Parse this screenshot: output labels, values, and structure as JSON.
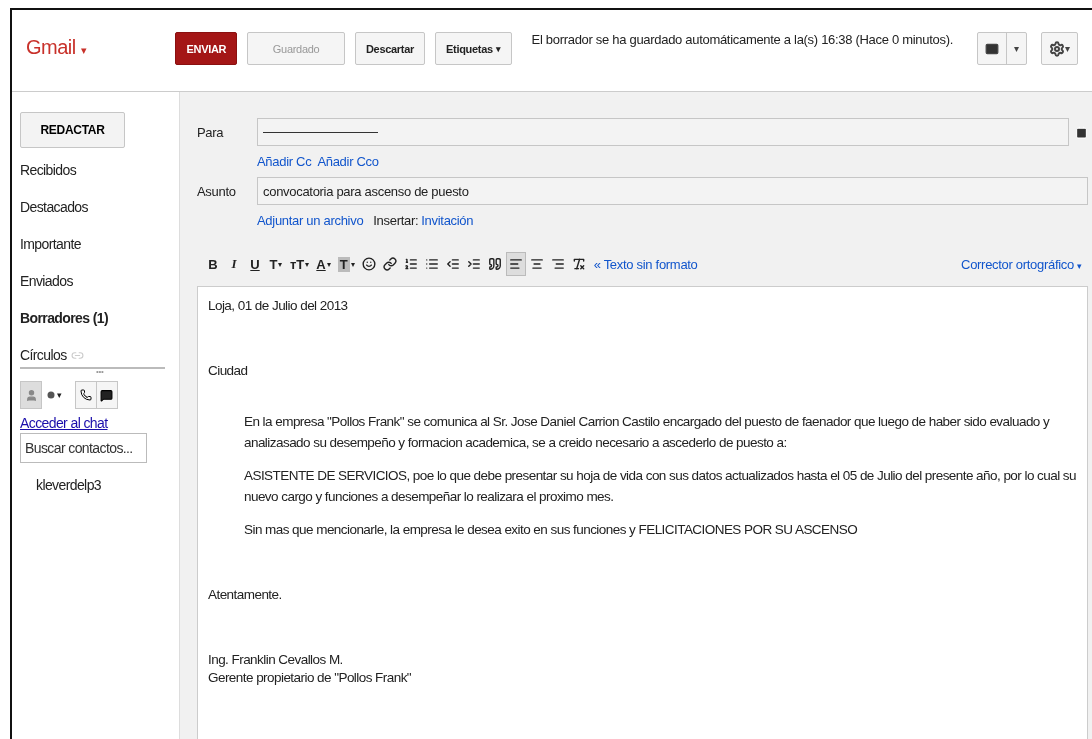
{
  "app": {
    "logo": "Gmail",
    "logo_caret": "▾"
  },
  "top_bar": {
    "send": "ENVIAR",
    "saved": {
      "label": "Guardado",
      "disabled": true
    },
    "discard": "Descartar",
    "labels": {
      "label": "Etiquetas",
      "caret": "▾"
    },
    "status": "El borrador se ha guardado automáticamente a la(s) 16:38 (Hace 0 minutos).",
    "settings_caret": "▾",
    "view_caret": "▾"
  },
  "sidebar": {
    "compose": "REDACTAR",
    "items": [
      {
        "label": "Recibidos",
        "selected": false
      },
      {
        "label": "Destacados",
        "selected": false
      },
      {
        "label": "Importante",
        "selected": false
      },
      {
        "label": "Enviados",
        "selected": false
      },
      {
        "label": "Borradores (1)",
        "selected": true
      }
    ],
    "circles": "Círculos",
    "more": "•••",
    "status_caret": "▾",
    "chat_link": "Acceder al chat",
    "contact_search": {
      "placeholder": "Buscar contactos..."
    },
    "contacts": [
      "kleverdelp3"
    ]
  },
  "compose": {
    "to_label": "Para",
    "add_cc": "Añadir Cc",
    "add_bcc": "Añadir Cco",
    "subject_label": "Asunto",
    "subject": "convocatoria para ascenso de puesto",
    "attach": "Adjuntar un archivo",
    "insert_label": "Insertar:",
    "insert_link": "Invitación",
    "format_buttons": [
      {
        "kind": "bold",
        "label": "B",
        "selected": false
      },
      {
        "kind": "italic",
        "label": "I",
        "selected": false
      },
      {
        "kind": "underline",
        "label": "U",
        "selected": false
      },
      {
        "kind": "font",
        "label": "T",
        "caret": "▾",
        "selected": false
      },
      {
        "kind": "size",
        "label": "тT",
        "caret": "▾",
        "selected": false
      },
      {
        "kind": "color",
        "label": "A",
        "caret": "▾",
        "selected": false
      },
      {
        "kind": "highlight",
        "label": "T",
        "caret": "▾",
        "selected": false
      },
      {
        "kind": "emoji",
        "selected": false
      },
      {
        "kind": "link",
        "selected": false
      },
      {
        "kind": "numbered",
        "selected": false
      },
      {
        "kind": "bulleted",
        "selected": false
      },
      {
        "kind": "outdent",
        "selected": false
      },
      {
        "kind": "indent",
        "selected": false
      },
      {
        "kind": "quote",
        "selected": false
      },
      {
        "kind": "align-left",
        "selected": true
      },
      {
        "kind": "align-center",
        "selected": false
      },
      {
        "kind": "align-right",
        "selected": false
      },
      {
        "kind": "clear",
        "selected": false
      }
    ],
    "plain_text": "« Texto sin formato",
    "spellcheck": "Corrector ortográfico",
    "spellcheck_caret": "▾",
    "body": [
      {
        "kind": "plain",
        "text": "Loja, 01 de Julio del 2013"
      },
      {
        "kind": "section",
        "text": "Ciudad"
      },
      {
        "kind": "section-indented",
        "text": "En la empresa \"Pollos Frank\" se comunica al Sr. Jose Daniel Carrion Castilo encargado del puesto de faenador que luego de haber sido evaluado y analizasado su desempeño y formacion academica, se a creido necesario a ascederlo de puesto a:"
      },
      {
        "kind": "indented",
        "text": "ASISTENTE DE SERVICIOS, poe lo que debe presentar su hoja de vida con sus datos actualizados hasta el 05 de Julio del presente año, por lo cual su nuevo cargo y funciones a desempeñar lo realizara el proximo mes."
      },
      {
        "kind": "indented",
        "text": "Sin mas que mencionarle, la empresa le desea exito en sus funciones y FELICITACIONES POR SU ASCENSO"
      },
      {
        "kind": "section",
        "text": "Atentamente."
      },
      {
        "kind": "section",
        "text": "Ing. Franklin Cevallos M."
      },
      {
        "kind": "tight",
        "text": "Gerente propietario de \"Pollos Frank\""
      }
    ]
  }
}
